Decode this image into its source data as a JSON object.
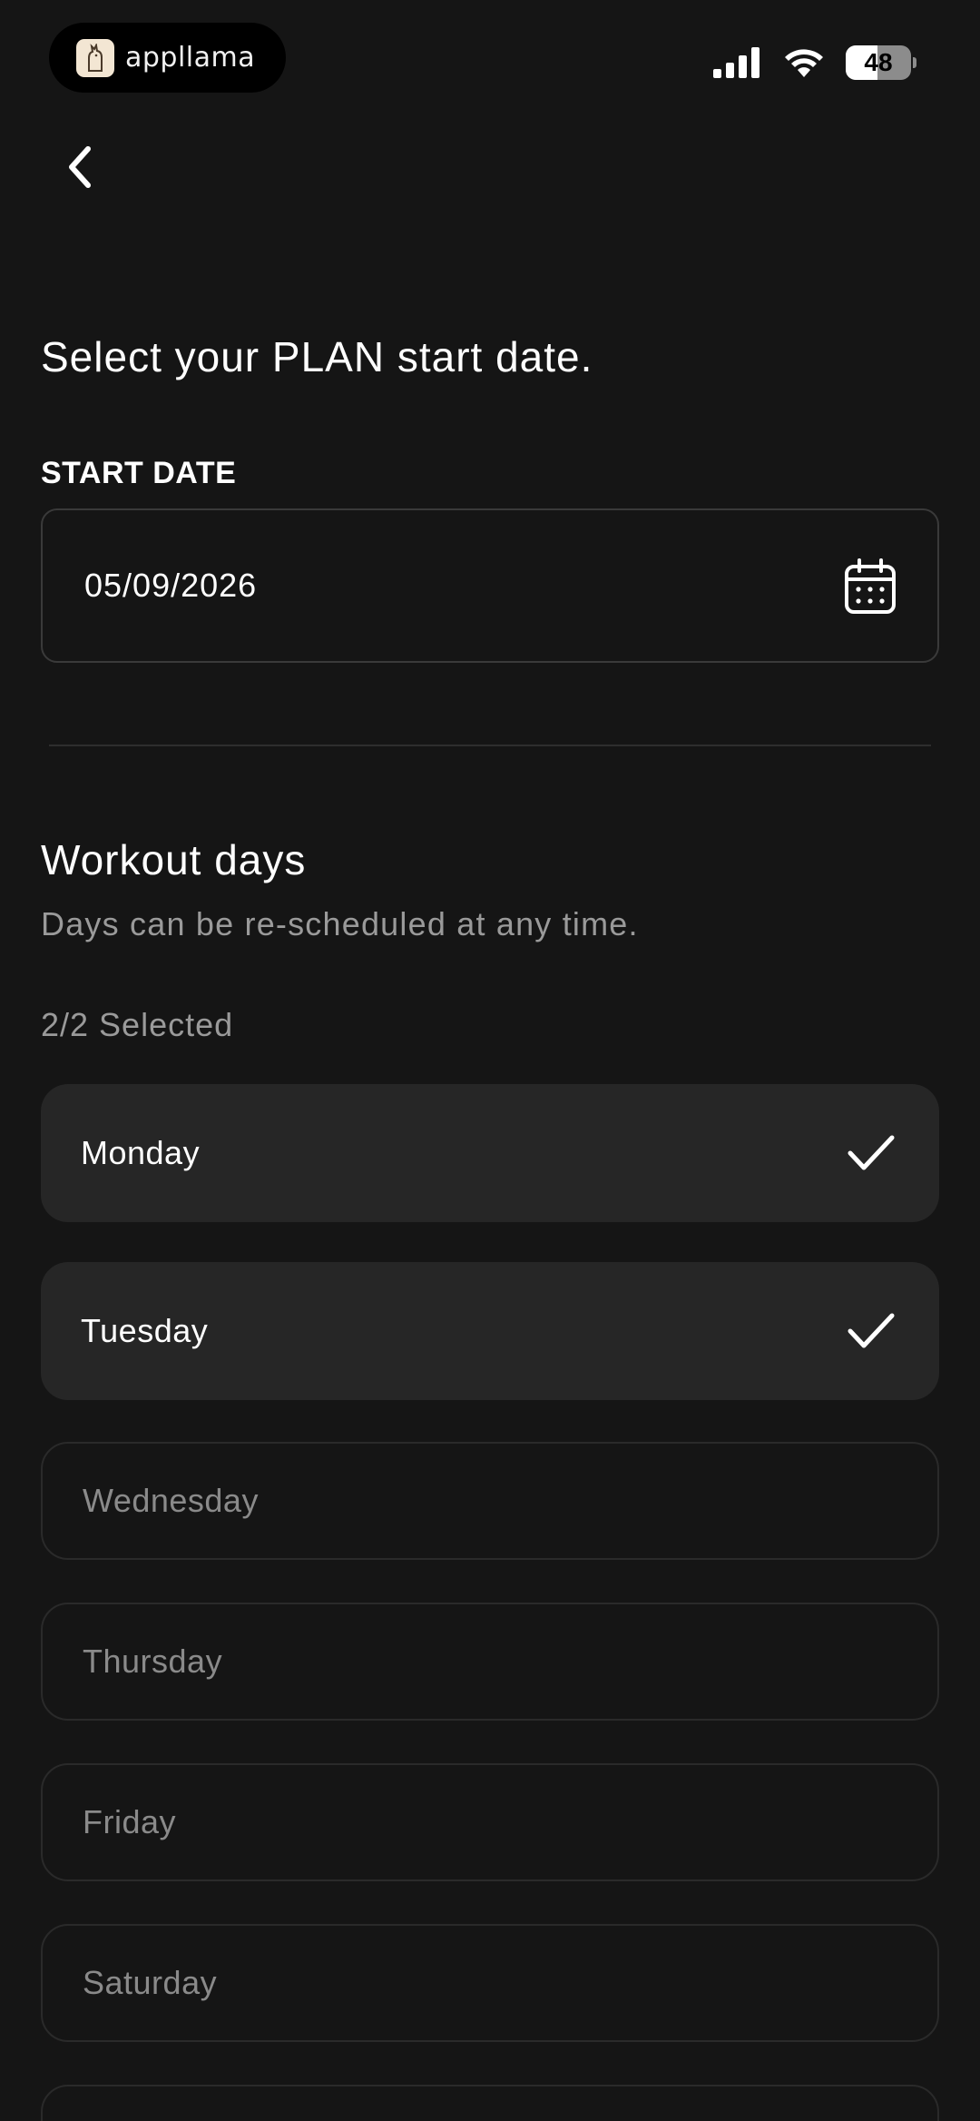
{
  "status_bar": {
    "app_name": "appllama",
    "battery": "48",
    "battery_level": 0.48
  },
  "header": {
    "title": "Select your PLAN start date.",
    "start_date_label": "START DATE",
    "start_date_value": "05/09/2026"
  },
  "workout": {
    "title": "Workout days",
    "subtitle": "Days can be re-scheduled at any time.",
    "selected_count": "2/2 Selected",
    "days": [
      {
        "label": "Monday",
        "selected": true
      },
      {
        "label": "Tuesday",
        "selected": true
      },
      {
        "label": "Wednesday",
        "selected": false
      },
      {
        "label": "Thursday",
        "selected": false
      },
      {
        "label": "Friday",
        "selected": false
      },
      {
        "label": "Saturday",
        "selected": false
      },
      {
        "label": "",
        "selected": false
      }
    ]
  },
  "colors": {
    "background": "#151515",
    "selected_row": "#262626",
    "muted_text": "#9a9a9a"
  }
}
